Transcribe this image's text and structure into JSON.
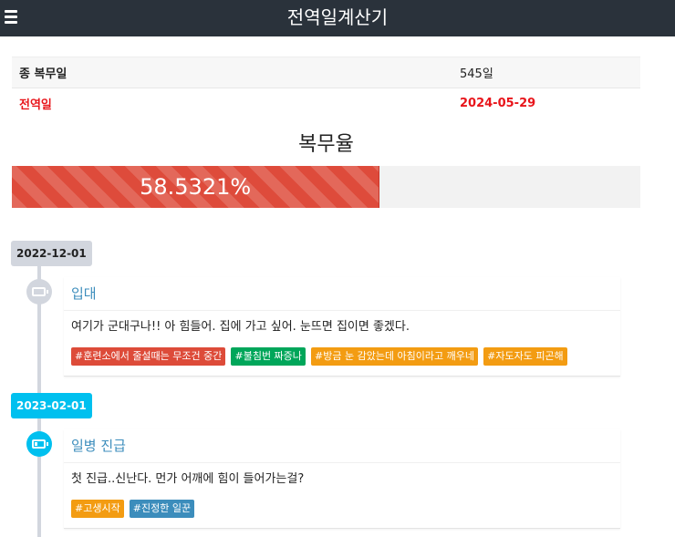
{
  "navbar": {
    "title": "전역일계산기",
    "menu_icon": "hamburger-menu-icon"
  },
  "summary": {
    "rows": [
      {
        "label": "종 복무일",
        "value": "545일"
      },
      {
        "label": "전역일",
        "value": "2024-05-29"
      }
    ]
  },
  "service_rate": {
    "title": "복무율",
    "percent": 58.5321,
    "label": "58.5321%",
    "color": "#de4b3b"
  },
  "timeline": [
    {
      "date": "2022-12-01",
      "icon": "battery-empty-icon",
      "title": "입대",
      "body": "여기가 군대구나!! 아 힘들어. 집에 가고 싶어. 눈뜨면 집이면 좋겠다.",
      "tags": [
        {
          "label": "#훈련소에서 줄설때는 무조건 중간",
          "color": "#dd4b39"
        },
        {
          "label": "#불침번 짜증나",
          "color": "#00a65a"
        },
        {
          "label": "#방금 눈 감았는데 아침이라고 깨우네",
          "color": "#f39c12"
        },
        {
          "label": "#자도자도 피곤해",
          "color": "#f39c12"
        }
      ]
    },
    {
      "date": "2023-02-01",
      "icon": "battery-quarter-icon",
      "title": "일병 진급",
      "body": "첫 진급..신난다. 먼가 어깨에 힘이 들어가는걸?",
      "tags": [
        {
          "label": "#고생시작",
          "color": "#f39c12"
        },
        {
          "label": "#진정한 일꾼",
          "color": "#3c8dbc"
        }
      ]
    }
  ]
}
